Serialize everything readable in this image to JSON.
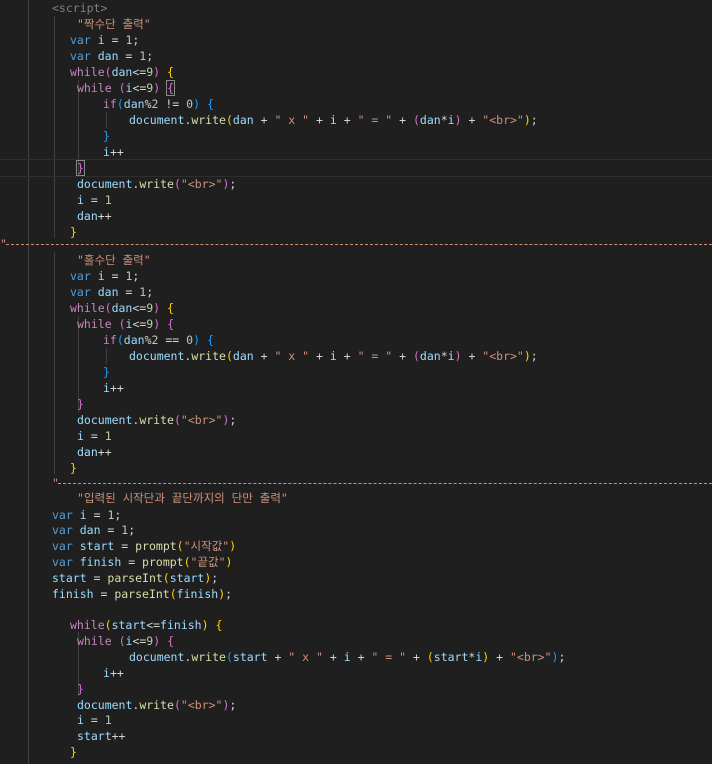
{
  "editor": {
    "language": "javascript",
    "theme_colors": {
      "background": "#1f1f1f",
      "keyword": "#569cd6",
      "control": "#c586c0",
      "string": "#ce9178",
      "number": "#b5cea8",
      "function": "#dcdcaa",
      "variable": "#9cdcfe",
      "bracket_level1": "#ffd700",
      "bracket_level2": "#da70d6",
      "bracket_level3": "#179fff"
    },
    "lines": [
      "<script>",
      "\"짝수단 출력\"",
      "var i = 1;",
      "var dan = 1;",
      "while(dan<=9) {",
      "while (i<=9) {",
      "if(dan%2 != 0) {",
      "document.write(dan + \" x \" + i + \" = \" + (dan*i) + \"<br>\");",
      "}",
      "i++",
      "}",
      "document.write(\"<br>\");",
      "i = 1",
      "dan++",
      "}",
      "\"",
      "\"홀수단 출력\"",
      "var i = 1;",
      "var dan = 1;",
      "while(dan<=9) {",
      "while (i<=9) {",
      "if(dan%2 == 0) {",
      "document.write(dan + \" x \" + i + \" = \" + (dan*i) + \"<br>\");",
      "}",
      "i++",
      "}",
      "document.write(\"<br>\");",
      "i = 1",
      "dan++",
      "}",
      "\"",
      "\"입력된 시작단과 끝단까지의 단만 출력\"",
      "var i = 1;",
      "var dan = 1;",
      "var start = prompt(\"시작값\")",
      "var finish = prompt(\"끝값\")",
      "start = parseInt(start);",
      "finish = parseInt(finish);",
      "while(start<=finish) {",
      "while (i<=9) {",
      "document.write(start + \" x \" + i + \" = \" + (start*i) + \"<br>\");",
      "i++",
      "}",
      "document.write(\"<br>\");",
      "i = 1",
      "start++",
      "}"
    ]
  }
}
